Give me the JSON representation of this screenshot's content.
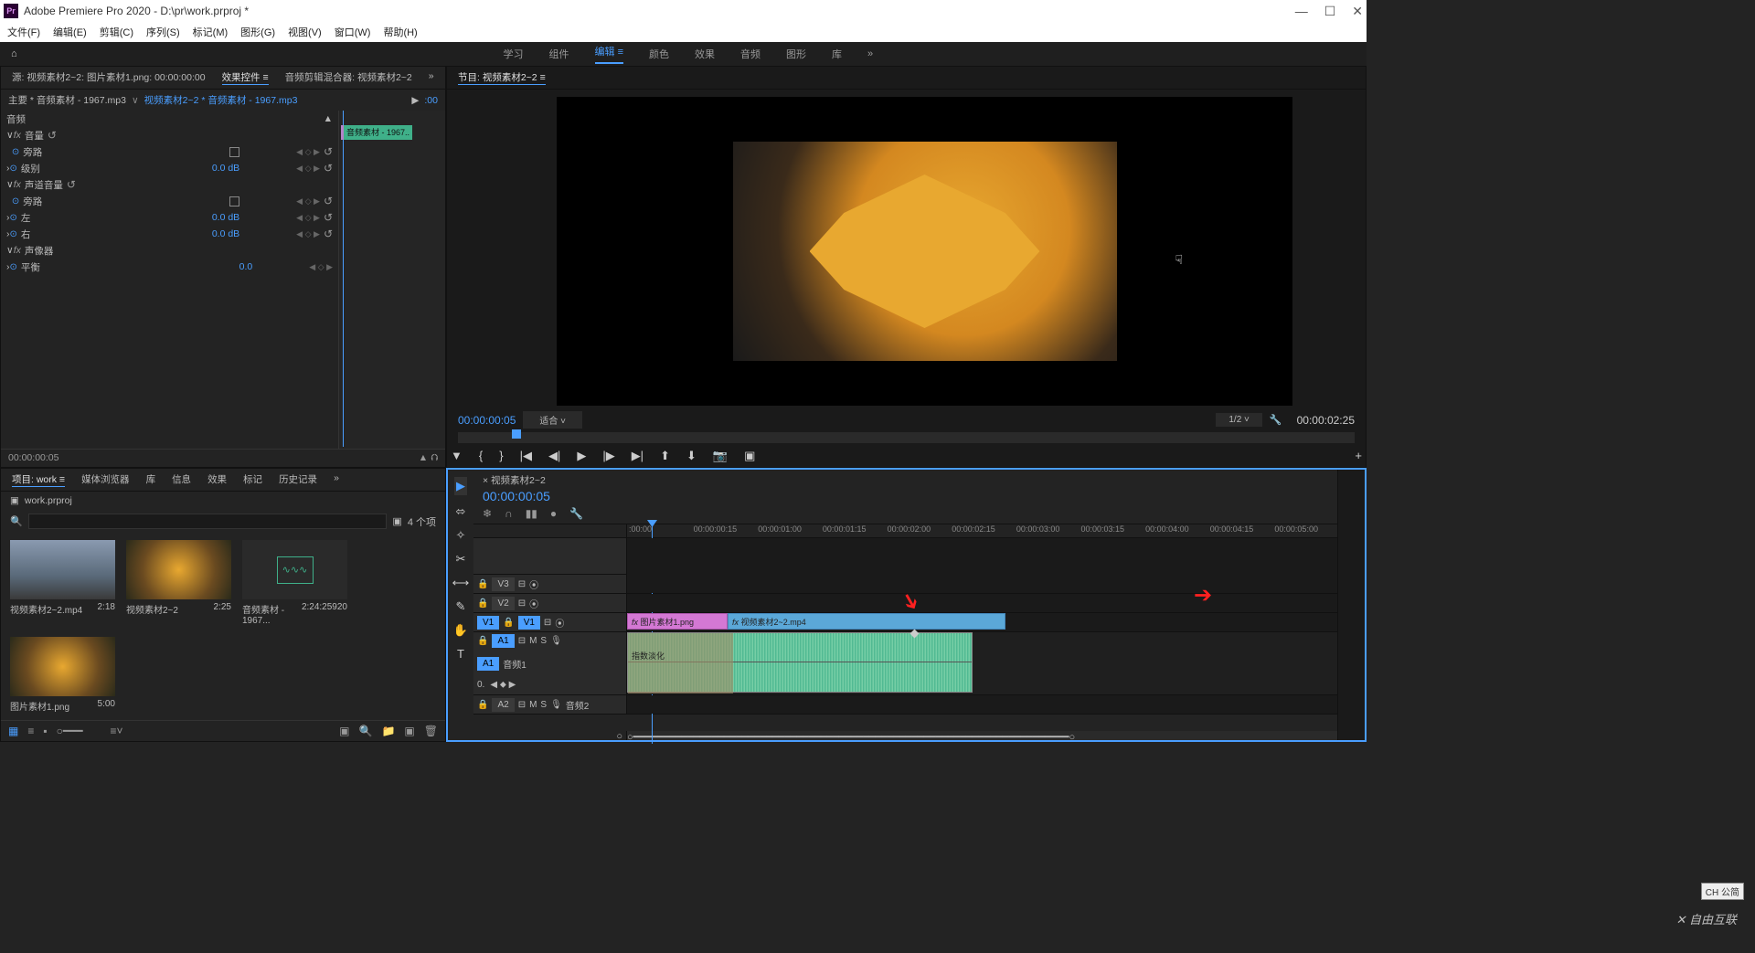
{
  "window": {
    "title": "Adobe Premiere Pro 2020 - D:\\pr\\work.prproj *"
  },
  "menu": {
    "file": "文件(F)",
    "edit": "编辑(E)",
    "clip": "剪辑(C)",
    "sequence": "序列(S)",
    "marker": "标记(M)",
    "graphics": "图形(G)",
    "view": "视图(V)",
    "window": "窗口(W)",
    "help": "帮助(H)"
  },
  "workspaces": {
    "learn": "学习",
    "assembly": "组件",
    "editing": "编辑",
    "color": "颜色",
    "effects": "效果",
    "audio": "音频",
    "graphics": "图形",
    "library": "库",
    "more": "»"
  },
  "source_panel": {
    "source_tab": "源: 视频素材2~2: 图片素材1.png: 00:00:00:00",
    "effect_controls_tab": "效果控件",
    "audio_mixer_tab": "音频剪辑混合器: 视频素材2~2",
    "master_label": "主要 * 音频素材 - 1967.mp3",
    "clip_link": "视频素材2~2 * 音频素材 - 1967.mp3",
    "clip_name": "音频素材 - 1967..",
    "sections": {
      "audio": "音频",
      "volume": "音量",
      "bypass": "旁路",
      "level": "级别",
      "level_val": "0.0 dB",
      "channel_volume": "声道音量",
      "bypass2": "旁路",
      "left": "左",
      "left_val": "0.0 dB",
      "right": "右",
      "right_val": "0.0 dB",
      "panner": "声像器",
      "balance": "平衡",
      "balance_val": "0.0"
    },
    "tc_start": ":00",
    "footer_tc": "00:00:00:05"
  },
  "program_panel": {
    "tab": "节目: 视频素材2~2",
    "tc_left": "00:00:00:05",
    "fit_label": "适合",
    "scale_label": "1/2",
    "tc_right": "00:00:02:25"
  },
  "project_panel": {
    "tabs": {
      "project": "项目: work",
      "media_browser": "媒体浏览器",
      "library": "库",
      "info": "信息",
      "effects": "效果",
      "markers": "标记",
      "history": "历史记录"
    },
    "breadcrumb": "work.prproj",
    "item_count": "4 个项",
    "items": [
      {
        "name": "视频素材2~2.mp4",
        "dur": "2:18"
      },
      {
        "name": "视频素材2~2",
        "dur": "2:25"
      },
      {
        "name": "音频素材 - 1967...",
        "dur": "2:24:25920"
      },
      {
        "name": "图片素材1.png",
        "dur": "5:00"
      }
    ]
  },
  "timeline": {
    "seq_tab": "× 视频素材2~2",
    "tc": "00:00:00:05",
    "ruler": [
      ":00:00",
      "00:00:00:15",
      "00:00:01:00",
      "00:00:01:15",
      "00:00:02:00",
      "00:00:02:15",
      "00:00:03:00",
      "00:00:03:15",
      "00:00:04:00",
      "00:00:04:15",
      "00:00:05:00"
    ],
    "tracks": {
      "v3": "V3",
      "v2": "V2",
      "v1": "V1",
      "v1_src": "V1",
      "a1": "A1",
      "a1_src": "A1",
      "a2": "A2",
      "audio_label": "音频1",
      "audio2_label": "音频2",
      "m": "M",
      "s": "S",
      "o_label": "0."
    },
    "clips": {
      "v1_pic": "图片素材1.png",
      "v1_vid": "视频素材2~2.mp4",
      "fade_label": "指数淡化",
      "fx": "fx"
    }
  },
  "ime": "CH 公简",
  "watermark": "自由互联"
}
